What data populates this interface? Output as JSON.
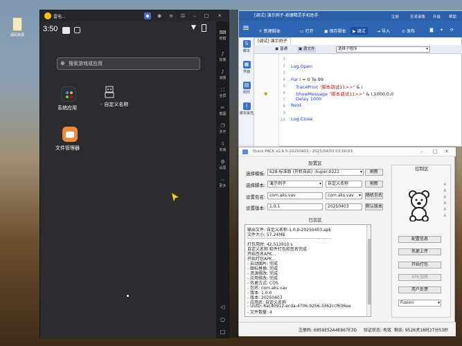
{
  "desktop": {
    "icon_label": "源码资源"
  },
  "emulator": {
    "window_title": "雷电...",
    "time": "3:50",
    "search_placeholder": "搜索游戏或应用",
    "apps": [
      {
        "label": "系统应用"
      },
      {
        "label": "自定义名称"
      },
      {
        "label": "文件管理器"
      }
    ],
    "side_tools": [
      {
        "label": "按键",
        "icon": "keyboard-icon"
      },
      {
        "label": "加量",
        "icon": "volume-up-icon"
      },
      {
        "label": "减量",
        "icon": "volume-down-icon"
      },
      {
        "label": "全屏",
        "icon": "fullscreen-icon"
      },
      {
        "label": "截图",
        "icon": "screenshot-icon"
      },
      {
        "label": "多开",
        "icon": "multi-instance-icon"
      },
      {
        "label": "安装",
        "icon": "install-icon"
      },
      {
        "label": "设置",
        "icon": "settings-icon"
      },
      {
        "label": "更多",
        "icon": "more-icon"
      }
    ],
    "nav": {
      "back": "◁",
      "home": "○",
      "recent": "□"
    }
  },
  "ide": {
    "title": "[调试] 演示例子-按键精灵手机助手",
    "menu": [
      "注册",
      "安卓录像",
      "升级",
      "帮助"
    ],
    "toolbar": [
      "新建脚本",
      "打开",
      "保存脚本",
      "调试",
      "导入",
      "发布"
    ],
    "left_tabs": [
      "脚本",
      "界面",
      "附件",
      "脚本属性"
    ],
    "tab_label": "[调试] 演示例子",
    "bar_left": "普通",
    "bar_src": "源文件",
    "bar_select": "选择子程序",
    "line_numbers": [
      "1",
      "2",
      "3",
      "4",
      "5",
      "6",
      "7",
      "8",
      "9",
      "10"
    ],
    "code": {
      "l2": "Log.Open",
      "l4_kw": "For",
      "l4_rest": " i = 0 To 99",
      "l5_fn": "TracePrint",
      "l5_str": " \"脚本调试11>>\"",
      "l5_rest": " & i",
      "l6_fn": "ShowMessage",
      "l6_str": " \"脚本调试11>>\"",
      "l6_rest": " & i,1000,0,0",
      "l7_fn": "Delay",
      "l7_num": " 1000",
      "l8": "Next",
      "l10": "Log.Close"
    }
  },
  "quickpack": {
    "title": "Quick PACK v2.6.5-20250403 - 2025/04/03 03:50:03",
    "config_title": "配置区",
    "rows": [
      {
        "label": "选择模板:",
        "value": "628-标准版 (开机自启) -Super-0222",
        "button": "刷新"
      },
      {
        "label": "选择脚本:",
        "value": "演示例子",
        "value2": "自定义名称",
        "button": "刷新"
      },
      {
        "label": "设置包名:",
        "value": "com.aks.vav",
        "value2": "com.aks.vav",
        "button": "随机包名"
      },
      {
        "label": "设置版本:",
        "value": "1.0.1",
        "value2": "20250403",
        "button": "默认版本"
      }
    ],
    "log_title": "日志区",
    "log_lines": [
      "输出文件: 自定义名称-1.0.0-20250403.apk",
      "文件大小: 57.24MB",
      "--------------------------------------------------------",
      "打包用时: 42.513910 s",
      "自定义名称 软件打包和签名完成",
      "开始签名APK...",
      "开始打包APK...",
      "- 启动图片: 完成",
      "- 图标替换: 完成",
      "- 资源修改: 完成",
      "- 应用修改: 完成",
      "- 热更方式: COS",
      "- 包名: com.aks.vav",
      "- 版本: 1.0.0",
      "- 版本: 20250403",
      "- 应用名: 自定义名称",
      "- UUID: 8ac40912-ecda-4706-9256-3362ccf606ee",
      "- 文件数量: 4"
    ],
    "control_title": "控制区",
    "control_buttons": [
      {
        "label": "配置信息",
        "enabled": true
      },
      {
        "label": "热更上传",
        "enabled": true
      },
      {
        "label": "开始打包",
        "enabled": true
      },
      {
        "label": "APK加固",
        "enabled": false
      },
      {
        "label": "用户反馈",
        "enabled": true
      }
    ],
    "fusion": "Fusion",
    "status": {
      "reg": "注册码: 6859E52A4E867E3D",
      "auth": "验证状态: 有效",
      "remain": "剩余: 9526天18时27分53秒"
    }
  }
}
